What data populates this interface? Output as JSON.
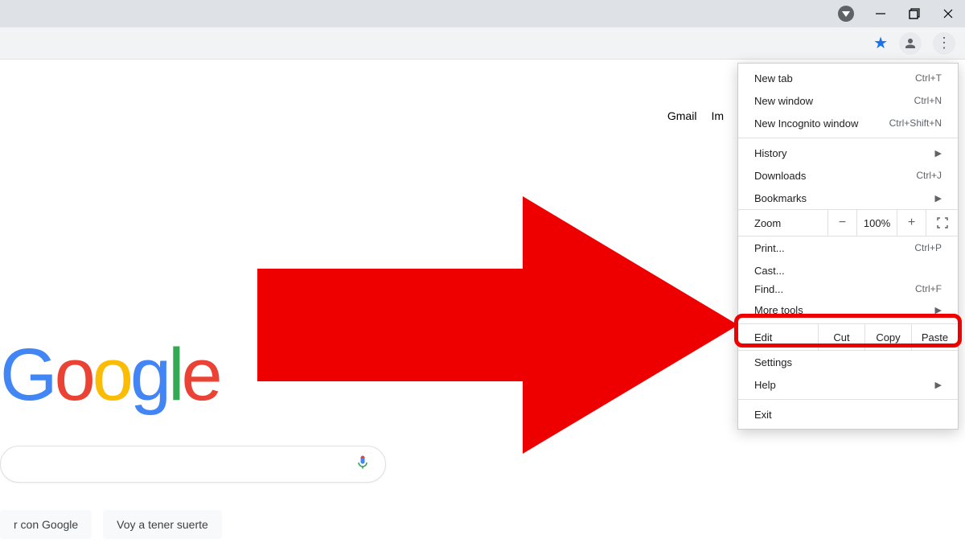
{
  "window_controls": {
    "minimize": "Minimize",
    "maximize": "Maximize",
    "close": "Close"
  },
  "toolbar": {
    "star": "Bookmark this tab",
    "profile": "You",
    "menu": "Customize and control Google Chrome"
  },
  "page": {
    "top_links": {
      "gmail": "Gmail",
      "images": "Im"
    },
    "logo": [
      "G",
      "o",
      "o",
      "g",
      "l",
      "e"
    ],
    "search_placeholder": "",
    "buttons": {
      "search": "r con Google",
      "lucky": "Voy a tener suerte"
    }
  },
  "menu": {
    "new_tab": {
      "label": "New tab",
      "shortcut": "Ctrl+T"
    },
    "new_window": {
      "label": "New window",
      "shortcut": "Ctrl+N"
    },
    "new_incognito": {
      "label": "New Incognito window",
      "shortcut": "Ctrl+Shift+N"
    },
    "history": {
      "label": "History"
    },
    "downloads": {
      "label": "Downloads",
      "shortcut": "Ctrl+J"
    },
    "bookmarks": {
      "label": "Bookmarks"
    },
    "zoom": {
      "label": "Zoom",
      "minus": "−",
      "value": "100%",
      "plus": "+"
    },
    "print": {
      "label": "Print...",
      "shortcut": "Ctrl+P"
    },
    "cast": {
      "label": "Cast..."
    },
    "find": {
      "label": "Find...",
      "shortcut": "Ctrl+F"
    },
    "more_tools": {
      "label": "More tools"
    },
    "edit": {
      "label": "Edit",
      "cut": "Cut",
      "copy": "Copy",
      "paste": "Paste"
    },
    "settings": {
      "label": "Settings"
    },
    "help": {
      "label": "Help"
    },
    "exit": {
      "label": "Exit"
    }
  },
  "annotation": {
    "arrow_color": "#ee0000",
    "highlight_target": "more-tools"
  }
}
